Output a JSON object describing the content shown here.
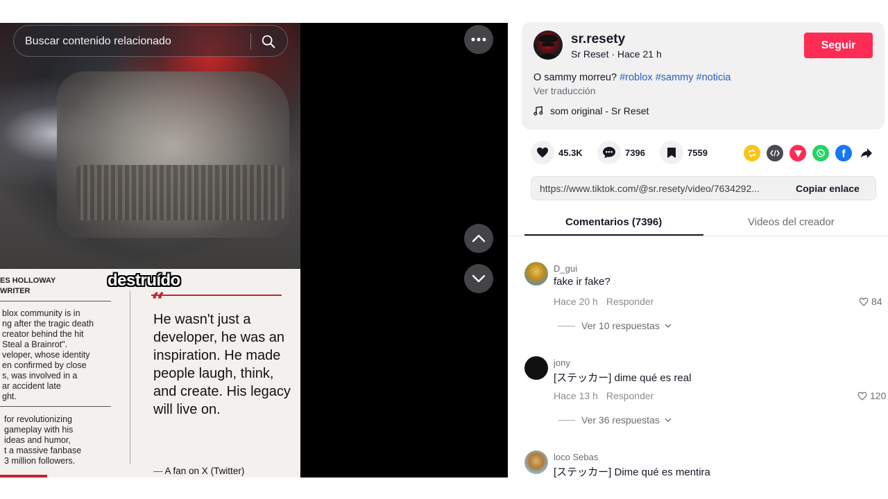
{
  "video": {
    "search_placeholder": "Buscar contenido relacionado",
    "caption": "destruído",
    "article": {
      "author_line1": "ES HOLLOWAY",
      "author_line2": "WRITER",
      "col1": [
        "blox community is in",
        "ng after the tragic death",
        "creator behind the hit",
        "Steal a Brainrot\".",
        "veloper, whose identity",
        "en confirmed by close",
        "s, was involved in a",
        "ar accident late",
        "ght."
      ],
      "col2": [
        "for revolutionizing",
        "gameplay with his",
        "ideas and humor,",
        "t a massive fanbase",
        "3 million followers."
      ],
      "quote": "He wasn't just a developer, he was an inspiration. He made people laugh, think, and create. His legacy will live on.",
      "attribution": "A fan on X (Twitter)"
    }
  },
  "creator": {
    "username": "sr.resety",
    "subline": "Sr Reset · Hace 21 h",
    "follow_label": "Seguir",
    "description_text": "O sammy morreu? ",
    "hashtags": [
      "#roblox",
      "#sammy",
      "#noticia"
    ],
    "translate_label": "Ver traducción",
    "music": "som original - Sr Reset"
  },
  "stats": {
    "likes": "45.3K",
    "comments": "7396",
    "saves": "7559"
  },
  "share_icons": [
    {
      "name": "repost-icon",
      "color": "#fcc419"
    },
    {
      "name": "embed-icon",
      "color": "#4a4b52"
    },
    {
      "name": "send-icon",
      "color": "#fe2c55"
    },
    {
      "name": "whatsapp-icon",
      "color": "#25d366"
    },
    {
      "name": "facebook-icon",
      "color": "#1877f2"
    },
    {
      "name": "share-arrow-icon",
      "color": "#161823"
    }
  ],
  "link": {
    "url": "https://www.tiktok.com/@sr.resety/video/7634292...",
    "copy_label": "Copiar enlace"
  },
  "tabs": {
    "comments": "Comentarios (7396)",
    "creator_videos": "Videos del creador"
  },
  "comments": [
    {
      "user": "D_gui",
      "text": "fake ir fake?",
      "time": "Hace 20 h",
      "reply_label": "Responder",
      "likes": "84",
      "replies": "Ver 10 respuestas",
      "avatar_color": "#c9a23a"
    },
    {
      "user": "jony",
      "text": "[ステッカー] dime qué es real",
      "time": "Hace 13 h",
      "reply_label": "Responder",
      "likes": "120",
      "replies": "Ver 36 respuestas",
      "avatar_color": "#111111"
    },
    {
      "user": "loco Sebas",
      "text": "[ステッカー] Dime qué es mentira",
      "avatar_color": "#8fb7c9"
    }
  ]
}
